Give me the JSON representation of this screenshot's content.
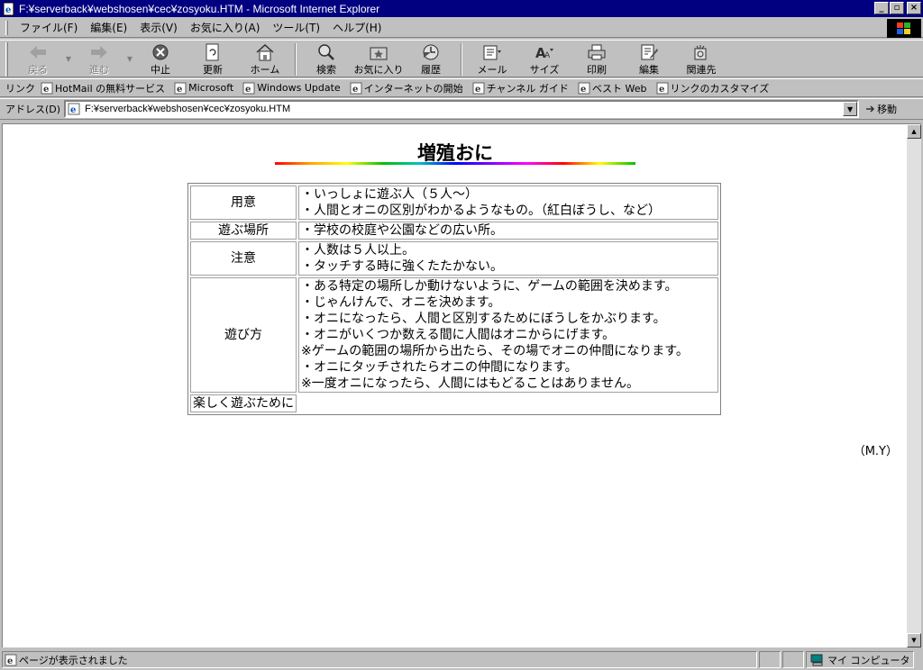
{
  "window": {
    "title": "F:¥serverback¥webshosen¥cec¥zosyoku.HTM - Microsoft Internet Explorer",
    "minimize": "_",
    "maximize": "▫",
    "close": "×"
  },
  "menu": [
    "ファイル(F)",
    "編集(E)",
    "表示(V)",
    "お気に入り(A)",
    "ツール(T)",
    "ヘルプ(H)"
  ],
  "toolbar": {
    "back": "戻る",
    "forward": "進む",
    "stop": "中止",
    "refresh": "更新",
    "home": "ホーム",
    "search": "検索",
    "favorites": "お気に入り",
    "history": "履歴",
    "mail": "メール",
    "size": "サイズ",
    "print": "印刷",
    "edit": "編集",
    "related": "関連先"
  },
  "links": {
    "label": "リンク",
    "items": [
      "HotMail の無料サービス",
      "Microsoft",
      "Windows Update",
      "インターネットの開始",
      "チャンネル ガイド",
      "ベスト Web",
      "リンクのカスタマイズ"
    ]
  },
  "address": {
    "label": "アドレス(D)",
    "url": "F:¥serverback¥webshosen¥cec¥zosyoku.HTM",
    "go": "移動"
  },
  "page": {
    "title": "増殖おに",
    "rows": [
      {
        "head": "用意",
        "lines": [
          "・いっしょに遊ぶ人（５人～）",
          "・人間とオニの区別がわかるようなもの。（紅白ぼうし、など）"
        ]
      },
      {
        "head": "遊ぶ場所",
        "lines": [
          "・学校の校庭や公園などの広い所。"
        ]
      },
      {
        "head": "注意",
        "lines": [
          "・人数は５人以上。",
          "・タッチする時に強くたたかない。"
        ]
      },
      {
        "head": "遊び方",
        "lines": [
          "・ある特定の場所しか動けないように、ゲームの範囲を決めます。",
          "・じゃんけんで、オニを決めます。",
          "・オニになったら、人間と区別するためにぼうしをかぶります。",
          "・オニがいくつか数える間に人間はオニからにげます。",
          "※ゲームの範囲の場所から出たら、その場でオニの仲間になります。",
          "・オニにタッチされたらオニの仲間になります。",
          "※一度オニになったら、人間にはもどることはありません。"
        ]
      },
      {
        "head": "楽しく遊ぶために",
        "lines": []
      }
    ],
    "credit": "（M.Y）"
  },
  "status": {
    "text": "ページが表示されました",
    "zone": "マイ コンピュータ"
  }
}
